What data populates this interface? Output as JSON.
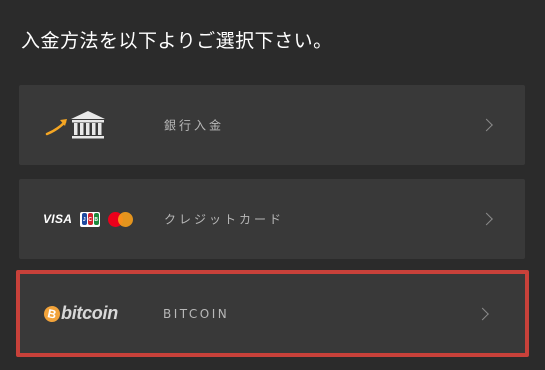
{
  "heading": "入金方法を以下よりご選択下さい。",
  "options": [
    {
      "label": "銀行入金",
      "icon": "bank-transfer-icon"
    },
    {
      "label": "クレジットカード",
      "icon": "credit-card-brands-icon",
      "brands": {
        "visa": "VISA",
        "jcb_j": "J",
        "jcb_c": "C",
        "jcb_b": "B"
      }
    },
    {
      "label": "BITCOIN",
      "icon": "bitcoin-logo-icon",
      "logo": {
        "symbol": "B",
        "word": "bitcoin"
      },
      "selected": true
    }
  ],
  "colors": {
    "background": "#2b2b2b",
    "option_background": "#393939",
    "selection_border": "#c8413a",
    "bank_arrow": "#f5a623",
    "bitcoin_orange": "#f2a33a"
  }
}
